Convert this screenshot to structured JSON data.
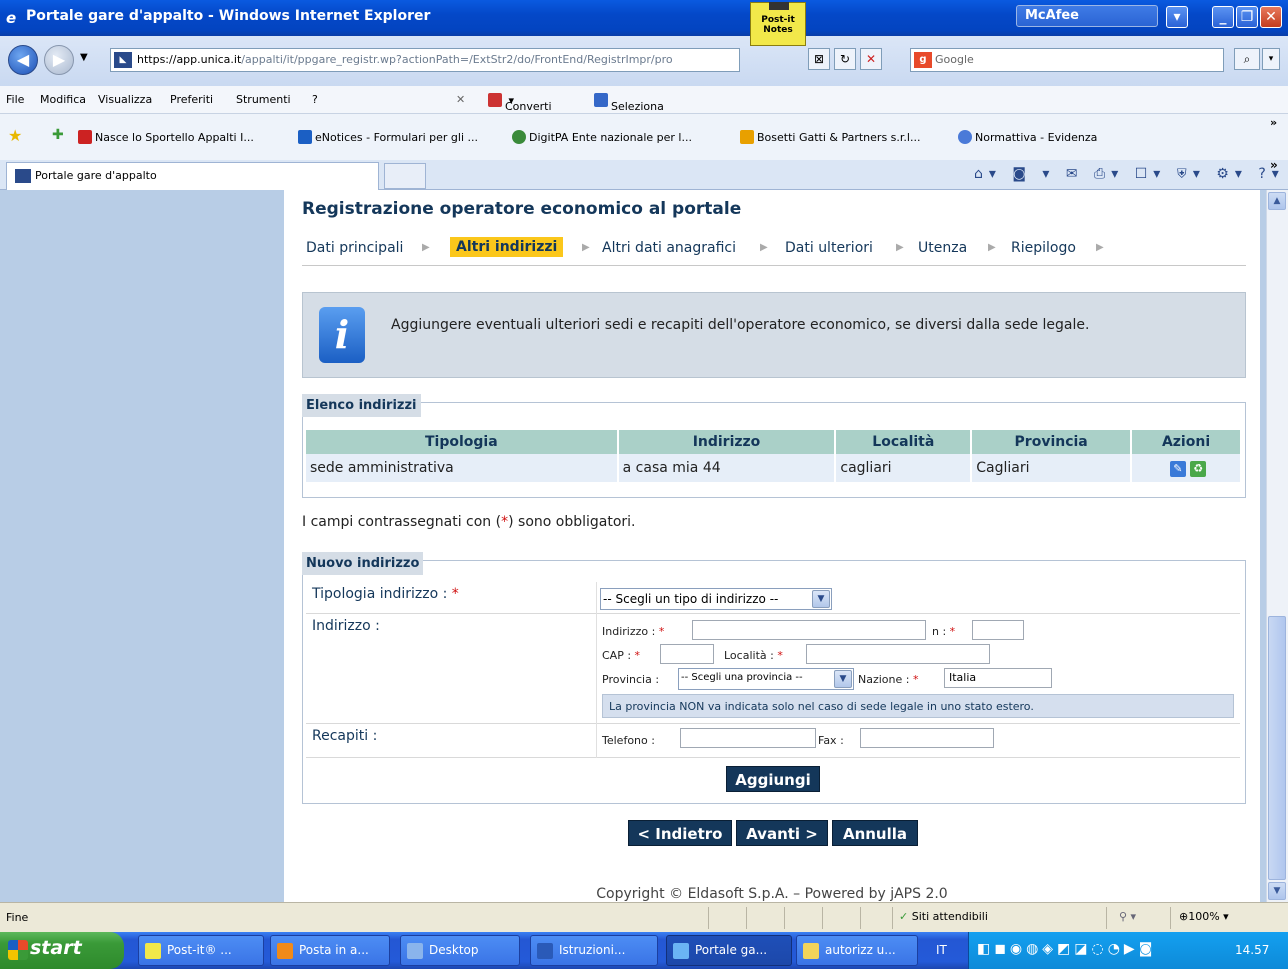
{
  "window": {
    "title": "Portale gare d'appalto - Windows Internet Explorer",
    "postit_label": "Post-it Notes",
    "mcafee": "McAfee"
  },
  "browser": {
    "url_prefix": "https://",
    "url_host": "app.unica.it",
    "url_path": "/appalti/it/ppgare_registr.wp?actionPath=/ExtStr2/do/FrontEnd/RegistrImpr/pro",
    "search_placeholder": "Google",
    "menu": [
      "File",
      "Modifica",
      "Visualizza",
      "Preferiti",
      "Strumenti",
      "?"
    ],
    "toolbar_convert": "Converti",
    "toolbar_select": "Seleziona",
    "favorites": [
      "Nasce lo Sportello Appalti I...",
      "eNotices - Formulari per gli ...",
      "DigitPA  Ente nazionale per l...",
      "Bosetti Gatti & Partners s.r.l...",
      "Normattiva - Evidenza"
    ],
    "tab_title": "Portale gare d'appalto"
  },
  "page": {
    "heading": "Registrazione operatore economico al portale",
    "steps": [
      "Dati principali",
      "Altri indirizzi",
      "Altri dati anagrafici",
      "Dati ulteriori",
      "Utenza",
      "Riepilogo"
    ],
    "active_step": "Altri indirizzi",
    "info_text": "Aggiungere eventuali ulteriori sedi e recapiti dell'operatore economico, se diversi dalla sede legale.",
    "list_legend": "Elenco indirizzi",
    "table_headers": [
      "Tipologia",
      "Indirizzo",
      "Località",
      "Provincia",
      "Azioni"
    ],
    "table_rows": [
      [
        "sede amministrativa",
        "a casa mia 44",
        "cagliari",
        "Cagliari"
      ]
    ],
    "required_note_pre": "I campi contrassegnati con (",
    "required_star": "*",
    "required_note_post": ") sono obbligatori.",
    "new_legend": "Nuovo indirizzo",
    "form": {
      "tipologia_label": "Tipologia indirizzo : ",
      "tipologia_select": "-- Scegli un tipo di indirizzo --",
      "indirizzo_label": "Indirizzo :",
      "indirizzo_field": "Indirizzo : ",
      "n_field": "n : ",
      "cap_field": "CAP : ",
      "localita_field": "Località : ",
      "provincia_field": "Provincia : ",
      "provincia_select": "-- Scegli una provincia --",
      "nazione_field": "Nazione : ",
      "nazione_value": "Italia",
      "provincia_note": "La provincia NON va indicata solo nel caso di sede legale in uno stato estero.",
      "recapiti_label": "Recapiti :",
      "telefono_field": "Telefono : ",
      "fax_field": "Fax : ",
      "add_button": "Aggiungi"
    },
    "nav_buttons": {
      "back": "< Indietro",
      "next": "Avanti >",
      "cancel": "Annulla"
    },
    "copyright": "Copyright © Eldasoft S.p.A. – Powered by jAPS 2.0"
  },
  "statusbar": {
    "left": "Fine",
    "zone": "Siti attendibili",
    "zoom": "100%"
  },
  "taskbar": {
    "start": "start",
    "tasks": [
      "Post-it® ...",
      "Posta in a...",
      "Desktop",
      "Istruzioni...",
      "Portale ga...",
      "autorizz u..."
    ],
    "lang": "IT",
    "clock": "14.57"
  }
}
